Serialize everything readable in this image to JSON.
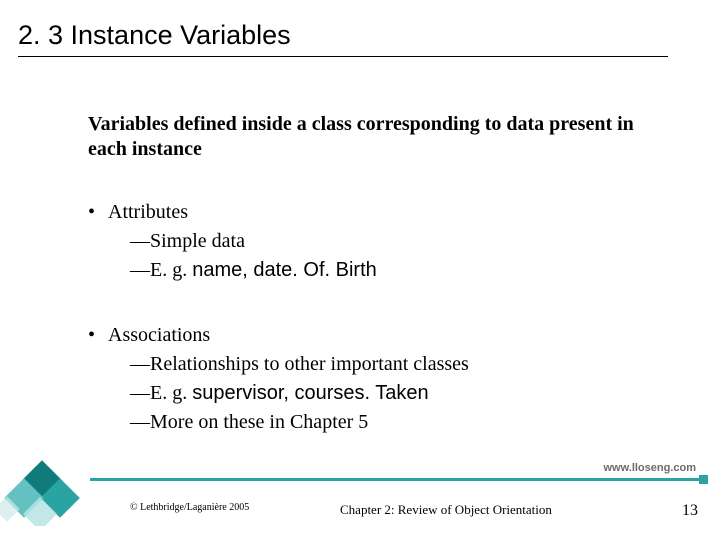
{
  "title": "2. 3 Instance Variables",
  "intro": "Variables defined inside a class corresponding to data present in each instance",
  "groups": [
    {
      "label": "Attributes",
      "items": [
        {
          "pre": "—",
          "text": "Simple data",
          "sans": ""
        },
        {
          "pre": "—",
          "text": "E. g. ",
          "sans": "name, date. Of. Birth"
        }
      ]
    },
    {
      "label": "Associations",
      "items": [
        {
          "pre": "—",
          "text": "Relationships to other important classes",
          "sans": ""
        },
        {
          "pre": "—",
          "text": "E. g. ",
          "sans": "supervisor, courses. Taken"
        },
        {
          "pre": "—",
          "text": "More on these in Chapter 5",
          "sans": ""
        }
      ]
    }
  ],
  "url": "www.lloseng.com",
  "footer": {
    "copyright": "© Lethbridge/Laganière 2005",
    "chapter": "Chapter 2: Review of Object Orientation",
    "page": "13"
  }
}
